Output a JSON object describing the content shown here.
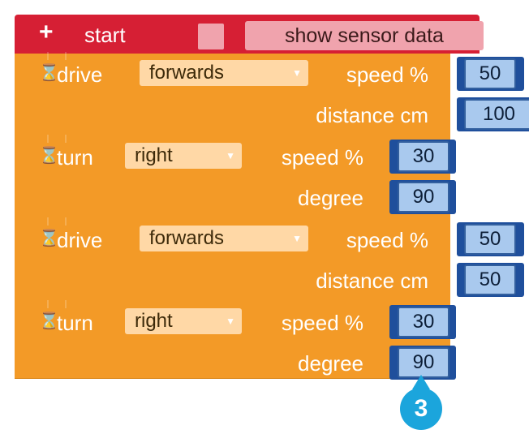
{
  "start": {
    "plus_icon": "+",
    "label": "start",
    "checkbox": false,
    "toggle_label": "show sensor data"
  },
  "blocks": [
    {
      "type": "drive",
      "label": "drive",
      "direction": "forwards",
      "speed_label": "speed %",
      "speed": "50",
      "param_label": "distance cm",
      "param": "100"
    },
    {
      "type": "turn",
      "label": "turn",
      "direction": "right",
      "speed_label": "speed %",
      "speed": "30",
      "param_label": "degree",
      "param": "90"
    },
    {
      "type": "drive",
      "label": "drive",
      "direction": "forwards",
      "speed_label": "speed %",
      "speed": "50",
      "param_label": "distance cm",
      "param": "50"
    },
    {
      "type": "turn",
      "label": "turn",
      "direction": "right",
      "speed_label": "speed %",
      "speed": "30",
      "param_label": "degree",
      "param": "90"
    }
  ],
  "step_badge": "3",
  "colors": {
    "start_block": "#d61f34",
    "command_block": "#f39a27",
    "socket": "#1f4f9c",
    "value_box": "#a9c9ee",
    "step_badge": "#1ba5dc"
  }
}
